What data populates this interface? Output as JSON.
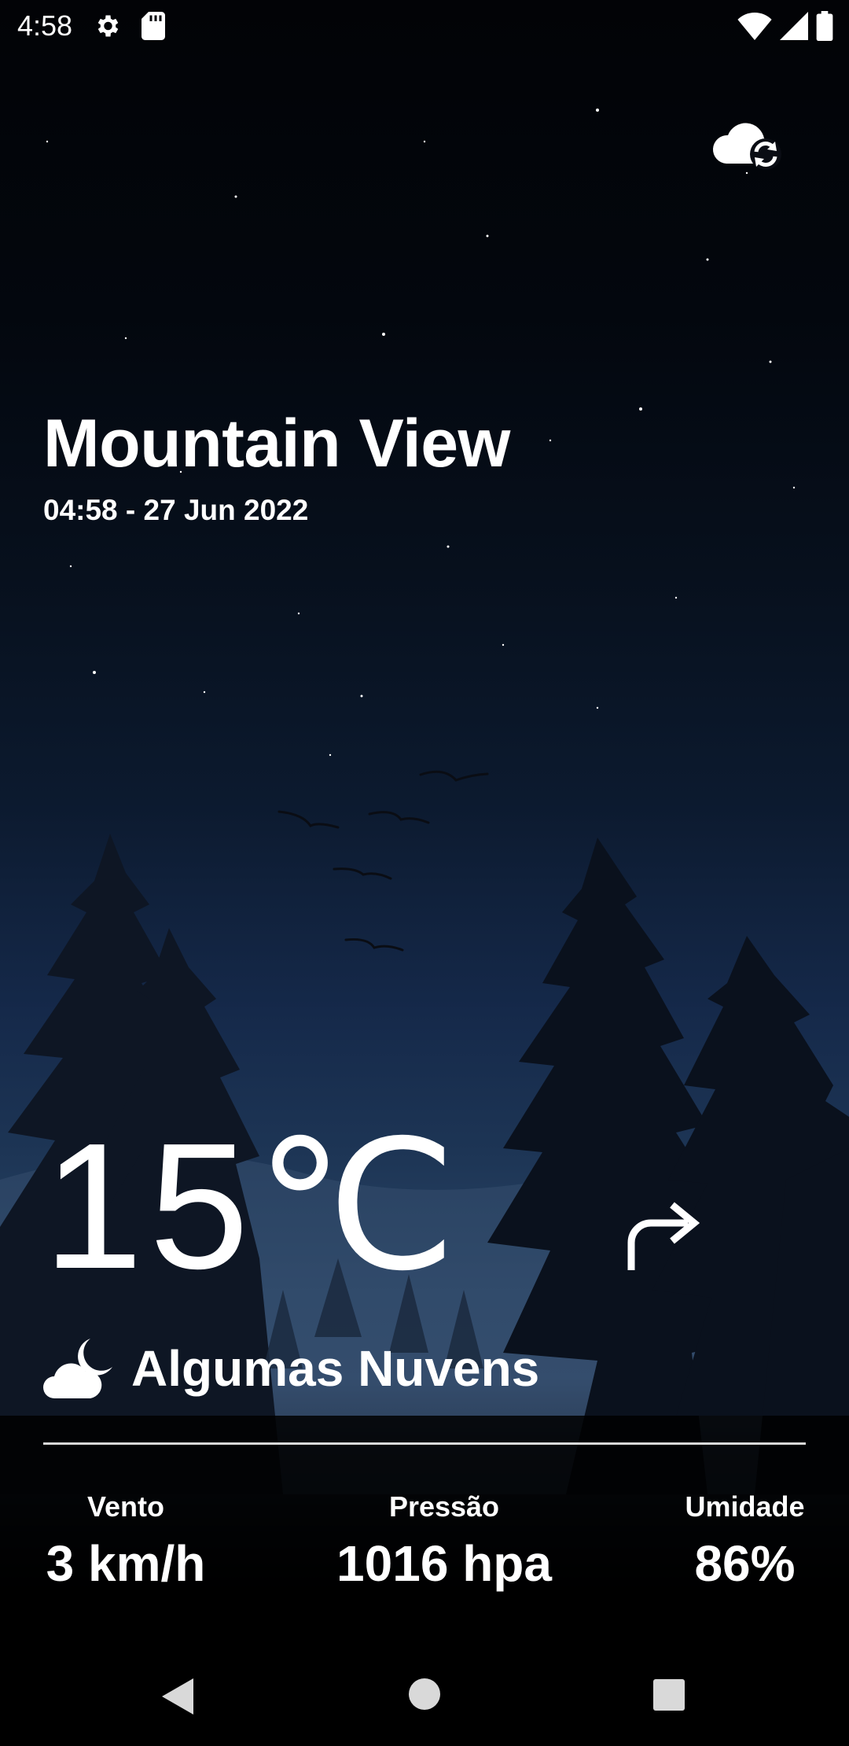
{
  "status_bar": {
    "time": "4:58",
    "icons": [
      "gear-icon",
      "sd-card-icon",
      "wifi-icon",
      "cell-signal-icon",
      "battery-icon"
    ]
  },
  "toolbar": {
    "refresh_icon": "cloud-refresh-icon"
  },
  "location": {
    "city": "Mountain View",
    "datetime": "04:58 - 27 Jun 2022"
  },
  "weather": {
    "temperature": "15℃",
    "condition": "Algumas Nuvens",
    "condition_icon": "cloud-moon-icon",
    "wind_direction_icon": "wind-direction-arrow-icon"
  },
  "stats": [
    {
      "label": "Vento",
      "value": "3 km/h"
    },
    {
      "label": "Pressão",
      "value": "1016 hpa"
    },
    {
      "label": "Umidade",
      "value": "86%"
    }
  ],
  "navigation": {
    "icons": [
      "back-icon",
      "home-icon",
      "recents-icon"
    ]
  },
  "colors": {
    "text": "#ffffff",
    "sky_top": "#020306",
    "sky_horizon": "#31496a"
  }
}
